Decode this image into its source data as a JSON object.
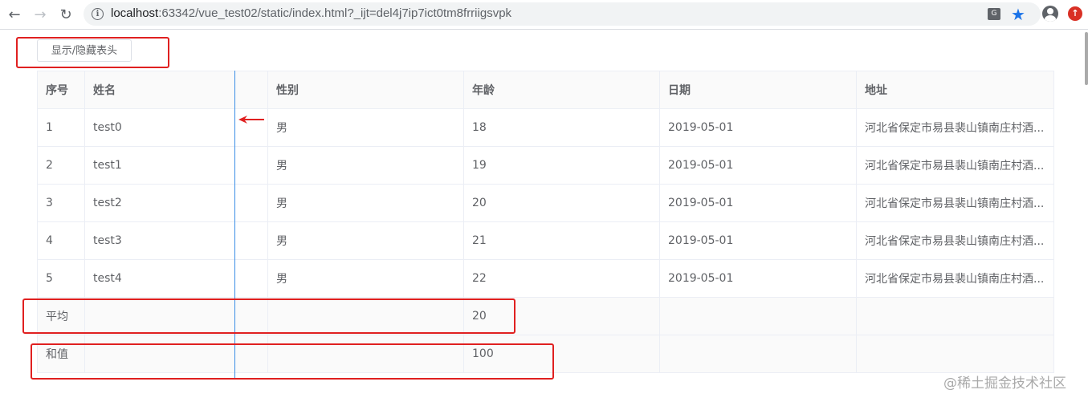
{
  "browser": {
    "url_host": "localhost",
    "url_rest": ":63342/vue_test02/static/index.html?_ijt=del4j7ip7ict0tm8frriigsvpk",
    "icons": [
      "back-icon",
      "forward-icon",
      "reload-icon",
      "info-icon",
      "translate-icon",
      "star-icon",
      "profile-icon",
      "update-icon"
    ]
  },
  "toggle_button": {
    "label": "显示/隐藏表头"
  },
  "table": {
    "headers": [
      "序号",
      "姓名",
      "性别",
      "年龄",
      "日期",
      "地址"
    ],
    "rows": [
      [
        "1",
        "test0",
        "男",
        "18",
        "2019-05-01",
        "河北省保定市易县裴山镇南庄村酒..."
      ],
      [
        "2",
        "test1",
        "男",
        "19",
        "2019-05-01",
        "河北省保定市易县裴山镇南庄村酒..."
      ],
      [
        "3",
        "test2",
        "男",
        "20",
        "2019-05-01",
        "河北省保定市易县裴山镇南庄村酒..."
      ],
      [
        "4",
        "test3",
        "男",
        "21",
        "2019-05-01",
        "河北省保定市易县裴山镇南庄村酒..."
      ],
      [
        "5",
        "test4",
        "男",
        "22",
        "2019-05-01",
        "河北省保定市易县裴山镇南庄村酒..."
      ]
    ],
    "footer": [
      [
        "平均",
        "",
        "",
        "20",
        "",
        ""
      ],
      [
        "和值",
        "",
        "",
        "100",
        "",
        ""
      ]
    ]
  },
  "watermark": "@稀土掘金技术社区",
  "colors": {
    "annotation": "#e02020",
    "accent": "#1a73e8",
    "resize_line": "#3a8ee6"
  }
}
